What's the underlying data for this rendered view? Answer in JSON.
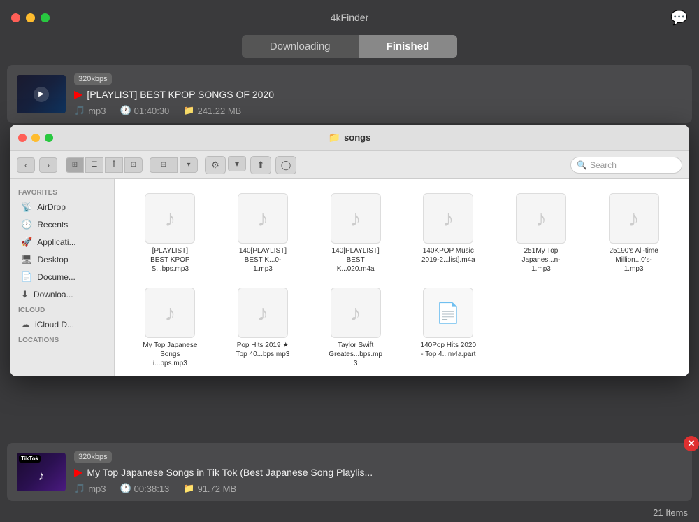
{
  "app": {
    "title": "4kFinder",
    "comment_icon": "💬"
  },
  "tabs": {
    "downloading": "Downloading",
    "finished": "Finished"
  },
  "download_top": {
    "badge": "320kbps",
    "title": "[PLAYLIST] BEST KPOP SONGS OF 2020",
    "format": "mp3",
    "duration": "01:40:30",
    "size": "241.22 MB",
    "yt_icon": "▶"
  },
  "finder": {
    "title": "songs",
    "search_placeholder": "Search",
    "nav": {
      "back": "‹",
      "forward": "›"
    },
    "sidebar": {
      "favorites_label": "Favorites",
      "items": [
        {
          "label": "AirDrop",
          "icon": "📡"
        },
        {
          "label": "Recents",
          "icon": "🕐"
        },
        {
          "label": "Applicati...",
          "icon": "🚀"
        },
        {
          "label": "Desktop",
          "icon": "🖥"
        },
        {
          "label": "Docume...",
          "icon": "📄"
        },
        {
          "label": "Downloa...",
          "icon": "⬇"
        }
      ],
      "icloud_label": "iCloud",
      "icloud_items": [
        {
          "label": "iCloud D...",
          "icon": "☁"
        }
      ],
      "locations_label": "Locations"
    },
    "files": [
      {
        "name": "[PLAYLIST] BEST KPOP S...bps.mp3"
      },
      {
        "name": "140[PLAYLIST] BEST K...0-1.mp3"
      },
      {
        "name": "140[PLAYLIST] BEST K...020.m4a"
      },
      {
        "name": "140KPOP Music 2019-2...list].m4a"
      },
      {
        "name": "251My Top Japanes...n-1.mp3"
      },
      {
        "name": "25190's All-time Million...0's-1.mp3"
      },
      {
        "name": "My Top Japanese Songs i...bps.mp3"
      },
      {
        "name": "Pop Hits 2019 ★ Top 40...bps.mp3"
      },
      {
        "name": "Taylor Swift Greates...bps.mp3"
      },
      {
        "name": "140Pop Hits 2020 - Top 4...m4a.part"
      }
    ]
  },
  "download_bottom": {
    "badge": "320kbps",
    "title": "My Top Japanese Songs in Tik Tok (Best Japanese Song Playlis...",
    "format": "mp3",
    "duration": "00:38:13",
    "size": "91.72 MB",
    "yt_icon": "▶",
    "tiktok": "TikTok"
  },
  "status_bar": {
    "items_count": "21 Items"
  }
}
